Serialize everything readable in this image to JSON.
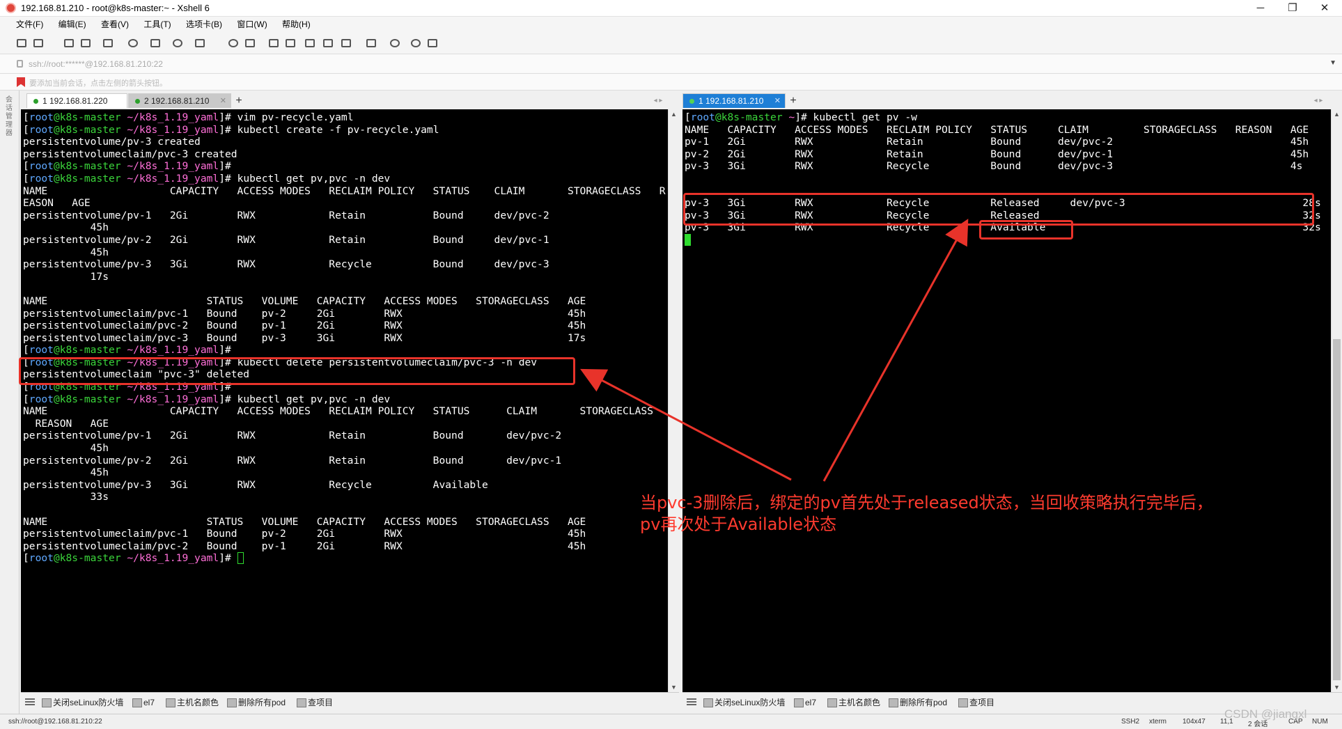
{
  "window": {
    "title": "192.168.81.210 - root@k8s-master:~ - Xshell 6",
    "controls": [
      "─",
      "❐",
      "✕"
    ]
  },
  "menu": [
    "文件(F)",
    "编辑(E)",
    "查看(V)",
    "工具(T)",
    "选项卡(B)",
    "窗口(W)",
    "帮助(H)"
  ],
  "address": "ssh://root:******@192.168.81.210:22",
  "hint": "要添加当前会话，点击左侧的箭头按钮。",
  "sidebar_label": "会话管理器",
  "left_pane": {
    "tabs": [
      {
        "label": "1 192.168.81.220",
        "state": "normal"
      },
      {
        "label": "2 192.168.81.210",
        "state": "active"
      }
    ],
    "prompt": {
      "user": "root",
      "host": "k8s-master",
      "dir": "~/k8s_1.19_yaml"
    },
    "lines": [
      {
        "type": "prompt",
        "cmd": "vim pv-recycle.yaml"
      },
      {
        "type": "prompt",
        "cmd": "kubectl create -f pv-recycle.yaml"
      },
      {
        "type": "text",
        "text": "persistentvolume/pv-3 created"
      },
      {
        "type": "text",
        "text": "persistentvolumeclaim/pvc-3 created"
      },
      {
        "type": "prompt",
        "cmd": ""
      },
      {
        "type": "prompt",
        "cmd": "kubectl get pv,pvc -n dev"
      },
      {
        "type": "text",
        "text": "NAME                    CAPACITY   ACCESS MODES   RECLAIM POLICY   STATUS    CLAIM       STORAGECLASS   R"
      },
      {
        "type": "text",
        "text": "EASON   AGE"
      },
      {
        "type": "text",
        "text": "persistentvolume/pv-1   2Gi        RWX            Retain           Bound     dev/pvc-2"
      },
      {
        "type": "text",
        "text": "           45h"
      },
      {
        "type": "text",
        "text": "persistentvolume/pv-2   2Gi        RWX            Retain           Bound     dev/pvc-1"
      },
      {
        "type": "text",
        "text": "           45h"
      },
      {
        "type": "text",
        "text": "persistentvolume/pv-3   3Gi        RWX            Recycle          Bound     dev/pvc-3"
      },
      {
        "type": "text",
        "text": "           17s"
      },
      {
        "type": "text",
        "text": ""
      },
      {
        "type": "text",
        "text": "NAME                          STATUS   VOLUME   CAPACITY   ACCESS MODES   STORAGECLASS   AGE"
      },
      {
        "type": "text",
        "text": "persistentvolumeclaim/pvc-1   Bound    pv-2     2Gi        RWX                           45h"
      },
      {
        "type": "text",
        "text": "persistentvolumeclaim/pvc-2   Bound    pv-1     2Gi        RWX                           45h"
      },
      {
        "type": "text",
        "text": "persistentvolumeclaim/pvc-3   Bound    pv-3     3Gi        RWX                           17s"
      },
      {
        "type": "prompt",
        "cmd": ""
      },
      {
        "type": "prompt",
        "cmd": "kubectl delete persistentvolumeclaim/pvc-3 -n dev"
      },
      {
        "type": "text",
        "text": "persistentvolumeclaim \"pvc-3\" deleted"
      },
      {
        "type": "prompt",
        "cmd": ""
      },
      {
        "type": "prompt",
        "cmd": "kubectl get pv,pvc -n dev"
      },
      {
        "type": "text",
        "text": "NAME                    CAPACITY   ACCESS MODES   RECLAIM POLICY   STATUS      CLAIM       STORAGECLASS"
      },
      {
        "type": "text",
        "text": "  REASON   AGE"
      },
      {
        "type": "text",
        "text": "persistentvolume/pv-1   2Gi        RWX            Retain           Bound       dev/pvc-2"
      },
      {
        "type": "text",
        "text": "           45h"
      },
      {
        "type": "text",
        "text": "persistentvolume/pv-2   2Gi        RWX            Retain           Bound       dev/pvc-1"
      },
      {
        "type": "text",
        "text": "           45h"
      },
      {
        "type": "text",
        "text": "persistentvolume/pv-3   3Gi        RWX            Recycle          Available"
      },
      {
        "type": "text",
        "text": "           33s"
      },
      {
        "type": "text",
        "text": ""
      },
      {
        "type": "text",
        "text": "NAME                          STATUS   VOLUME   CAPACITY   ACCESS MODES   STORAGECLASS   AGE"
      },
      {
        "type": "text",
        "text": "persistentvolumeclaim/pvc-1   Bound    pv-2     2Gi        RWX                           45h"
      },
      {
        "type": "text",
        "text": "persistentvolumeclaim/pvc-2   Bound    pv-1     2Gi        RWX                           45h"
      },
      {
        "type": "prompt",
        "cmd": "",
        "cursor": "hollow"
      }
    ]
  },
  "right_pane": {
    "tabs": [
      {
        "label": "1 192.168.81.210",
        "state": "active"
      }
    ],
    "prompt": {
      "user": "root",
      "host": "k8s-master",
      "dir": "~"
    },
    "lines": [
      {
        "type": "prompt",
        "cmd": "kubectl get pv -w"
      },
      {
        "type": "text",
        "text": "NAME   CAPACITY   ACCESS MODES   RECLAIM POLICY   STATUS     CLAIM         STORAGECLASS   REASON   AGE"
      },
      {
        "type": "text",
        "text": "pv-1   2Gi        RWX            Retain           Bound      dev/pvc-2                             45h"
      },
      {
        "type": "text",
        "text": "pv-2   2Gi        RWX            Retain           Bound      dev/pvc-1                             45h"
      },
      {
        "type": "text",
        "text": "pv-3   3Gi        RWX            Recycle          Bound      dev/pvc-3                             4s"
      },
      {
        "type": "text",
        "text": ""
      },
      {
        "type": "text",
        "text": ""
      },
      {
        "type": "text",
        "text": "pv-3   3Gi        RWX            Recycle          Released     dev/pvc-3                             28s"
      },
      {
        "type": "text",
        "text": "pv-3   3Gi        RWX            Recycle          Released                                           32s"
      },
      {
        "type": "text",
        "text": "pv-3   3Gi        RWX            Recycle          Available                                          32s"
      },
      {
        "type": "cursor"
      }
    ]
  },
  "quickbar": [
    "关闭seLinux防火墙",
    "el7",
    "主机名颜色",
    "删除所有pod",
    "查项目"
  ],
  "status": {
    "left": "ssh://root@192.168.81.210:22",
    "items": [
      "SSH2",
      "xterm",
      "104x47",
      "11,1",
      "2 会话",
      "CAP",
      "NUM"
    ]
  },
  "annotation": {
    "line1": "当pvc-3删除后，绑定的pv首先处于released状态，当回收策略执行完毕后，",
    "line2": "pv再次处于Available状态"
  },
  "watermark": "CSDN @jiangxl",
  "colors": {
    "accent_red": "#e8332a",
    "tab_blue": "#1e7fd6"
  }
}
